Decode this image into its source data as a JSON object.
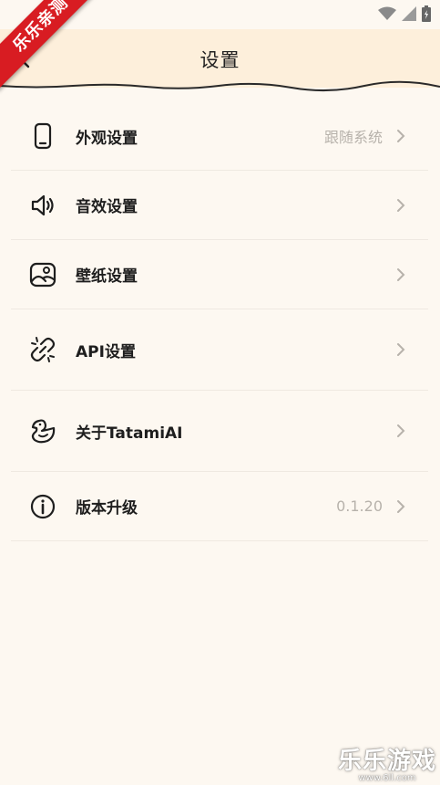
{
  "status_bar": {
    "icons": [
      "wifi-icon",
      "cell-signal-icon",
      "battery-icon"
    ]
  },
  "header": {
    "title": "设置",
    "back_icon": "back-arrow-icon"
  },
  "settings": {
    "items": [
      {
        "name": "appearance",
        "icon": "phone-icon",
        "label": "外观设置",
        "value": "跟随系统"
      },
      {
        "name": "sound",
        "icon": "speaker-icon",
        "label": "音效设置",
        "value": ""
      },
      {
        "name": "wallpaper",
        "icon": "image-icon",
        "label": "壁纸设置",
        "value": ""
      },
      {
        "name": "api",
        "icon": "link-broken-icon",
        "label": "API设置",
        "value": ""
      },
      {
        "name": "about",
        "icon": "duck-icon",
        "label": "关于TatamiAI",
        "value": ""
      },
      {
        "name": "version",
        "icon": "info-icon",
        "label": "版本升级",
        "value": "0.1.20"
      }
    ]
  },
  "overlay": {
    "corner_badge": "乐乐亲测",
    "watermark_text": "乐乐游戏",
    "watermark_url": "www.6ll.com"
  },
  "colors": {
    "header_bg": "#fdefdb",
    "page_bg": "#fdf8f1",
    "badge_red": "#d81c22",
    "muted_text": "#b7b2ab"
  }
}
